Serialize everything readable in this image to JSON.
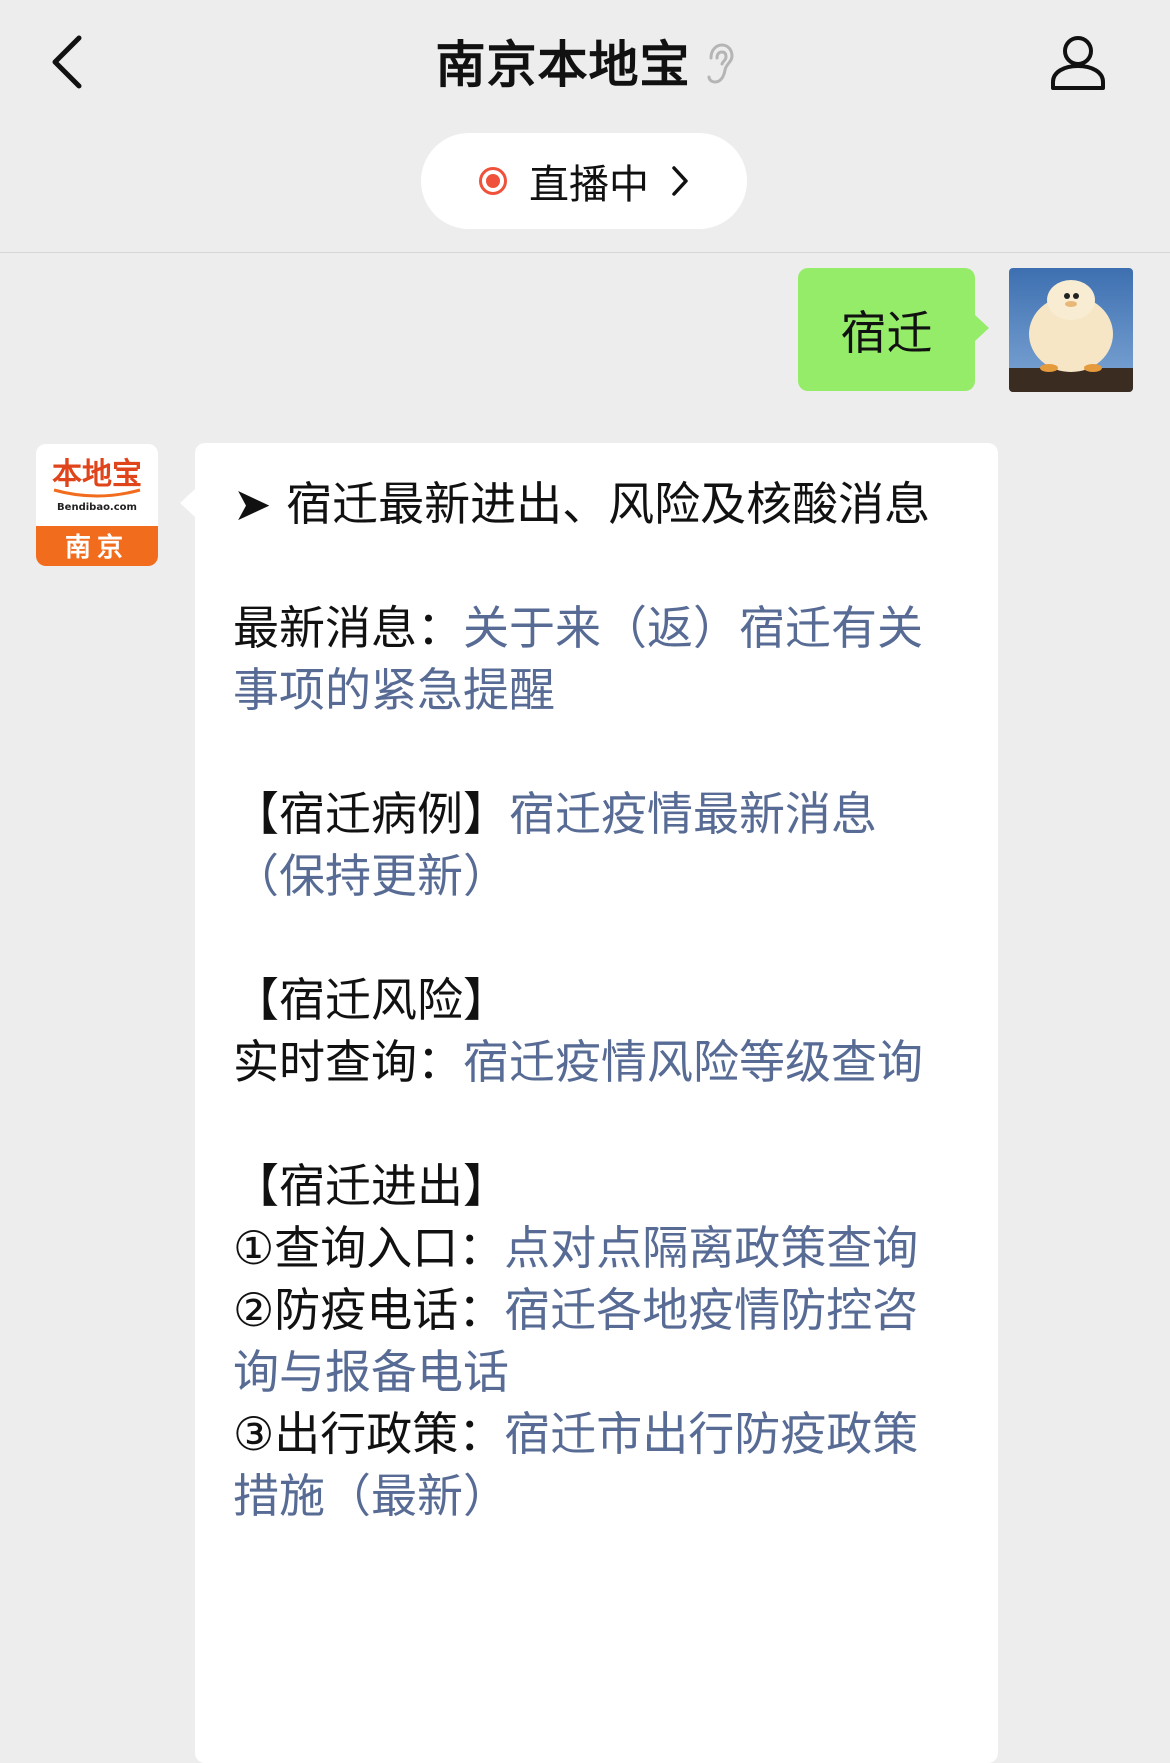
{
  "header": {
    "title": "南京本地宝",
    "live_label": "直播中"
  },
  "chat": {
    "outgoing_text": "宿迁",
    "bot_logo_text": "本地宝",
    "bot_logo_sub": "Bendibao.com",
    "bot_logo_city": "南京",
    "incoming": {
      "headline": "➤ 宿迁最新进出、风险及核酸消息",
      "latest_label": "最新消息：",
      "latest_link": "关于来（返）宿迁有关事项的紧急提醒",
      "cases_label": "【宿迁病例】",
      "cases_link": "宿迁疫情最新消息（保持更新）",
      "risk_label": "【宿迁风险】",
      "risk_query_label": "实时查询：",
      "risk_link": "宿迁疫情风险等级查询",
      "inout_label": "【宿迁进出】",
      "item1_label": "①查询入口：",
      "item1_link": "点对点隔离政策查询",
      "item2_label": "②防疫电话：",
      "item2_link": "宿迁各地疫情防控咨询与报备电话",
      "item3_label": "③出行政策：",
      "item3_link": "宿迁市出行防疫政策措施（最新）"
    }
  },
  "colors": {
    "outgoing_bubble": "#95ec69",
    "link": "#576b95",
    "live_dot": "#f0513a",
    "logo_orange": "#f26c1e"
  },
  "icons": {
    "back": "chevron-left-icon",
    "ear": "ear-icon",
    "profile": "person-icon",
    "live": "live-dot-icon",
    "live_more": "chevron-right-icon"
  }
}
